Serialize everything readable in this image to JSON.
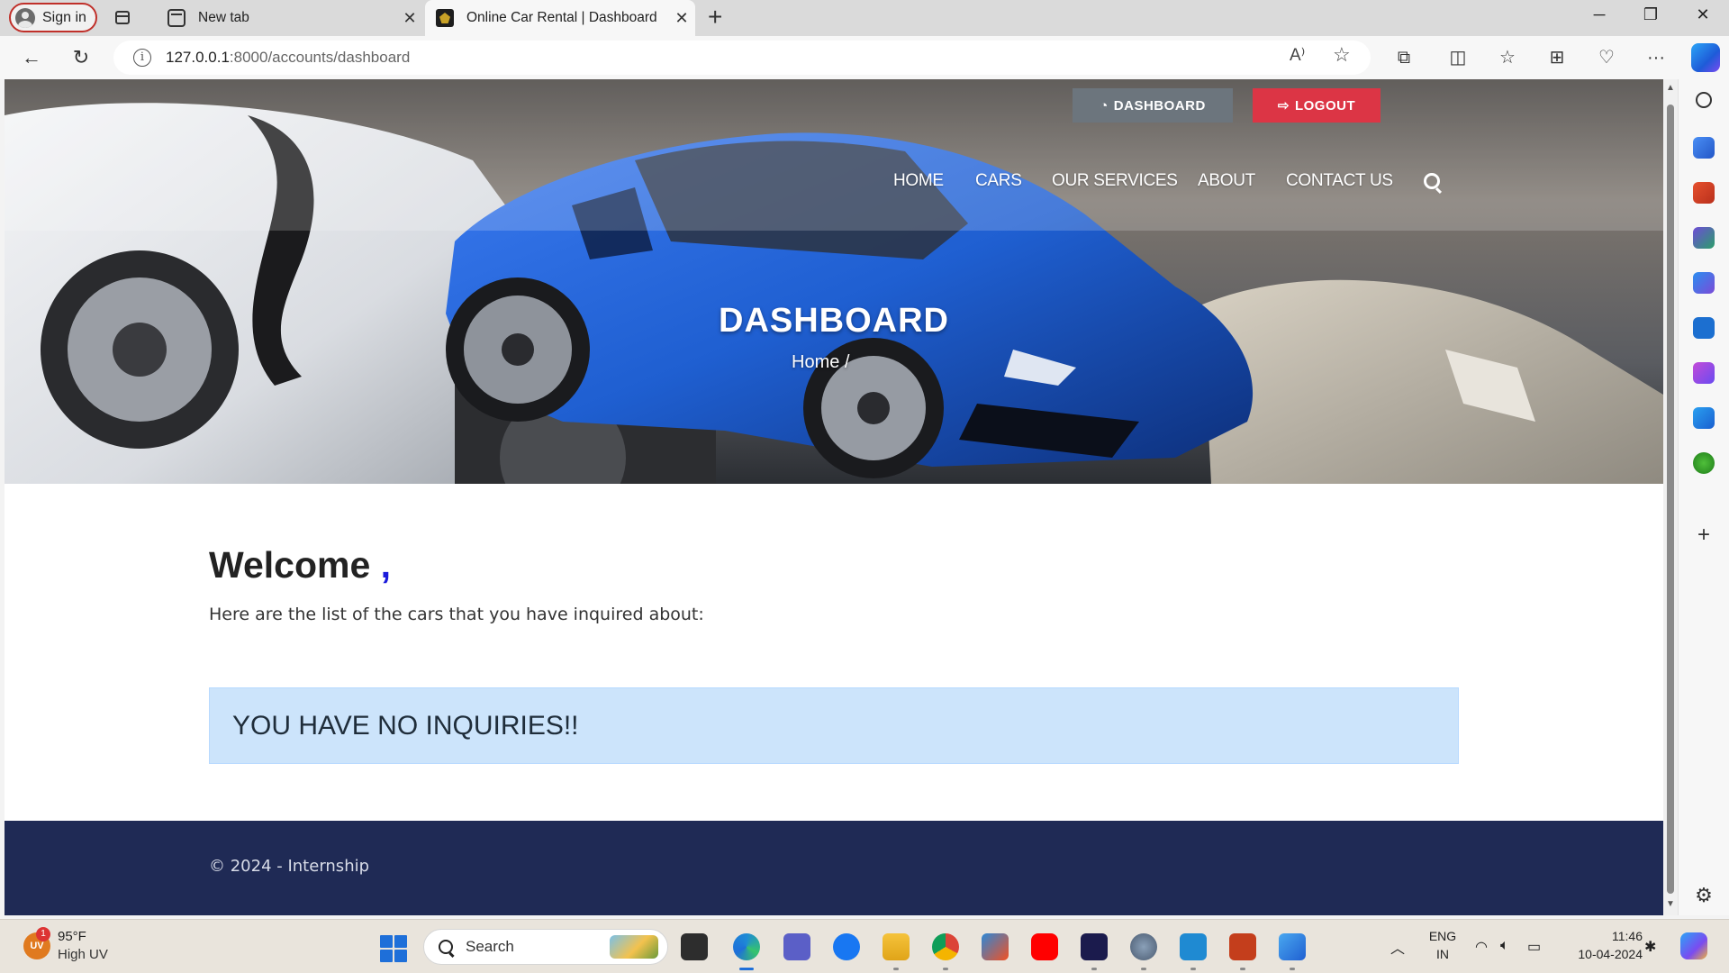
{
  "browser": {
    "signin_label": "Sign in",
    "tabs": [
      {
        "title": "New tab",
        "active": false
      },
      {
        "title": "Online Car Rental | Dashboard",
        "active": true
      }
    ],
    "url_host": "127.0.0.1",
    "url_path": ":8000/accounts/dashboard",
    "window_controls": {
      "minimize": "─",
      "restore": "❐",
      "close": "✕"
    }
  },
  "page": {
    "top_buttons": {
      "dashboard": "DASHBOARD",
      "logout": "LOGOUT"
    },
    "nav": [
      "HOME",
      "CARS",
      "OUR SERVICES",
      "ABOUT",
      "CONTACT US"
    ],
    "hero_title": "DASHBOARD",
    "breadcrumb": "Home /",
    "welcome": "Welcome",
    "welcome_comma": ",",
    "subtext": "Here are the list of the cars that you have inquired about:",
    "alert": "YOU HAVE NO INQUIRIES!!",
    "footer": "© 2024 - Internship",
    "colors": {
      "dashboard_btn": "#6c757d",
      "logout_btn": "#dc3545",
      "alert_bg": "#cce4fb",
      "footer_bg": "#1f2a55",
      "car_blue": "#1f5fd1"
    }
  },
  "taskbar": {
    "weather_temp": "95°F",
    "weather_desc": "High UV",
    "weather_badge": "1",
    "weather_icon_text": "UV",
    "search_label": "Search",
    "lang_top": "ENG",
    "lang_bottom": "IN",
    "time": "11:46",
    "date": "10-04-2024",
    "apps": [
      "widgets-app",
      "file-explorer-app",
      "edge-app",
      "teams-app",
      "facebook-app",
      "folder-app",
      "chrome-app",
      "store-app",
      "youtube-app",
      "webex-app",
      "settings-app",
      "vscode-app",
      "powerpoint-app",
      "photos-app"
    ]
  }
}
